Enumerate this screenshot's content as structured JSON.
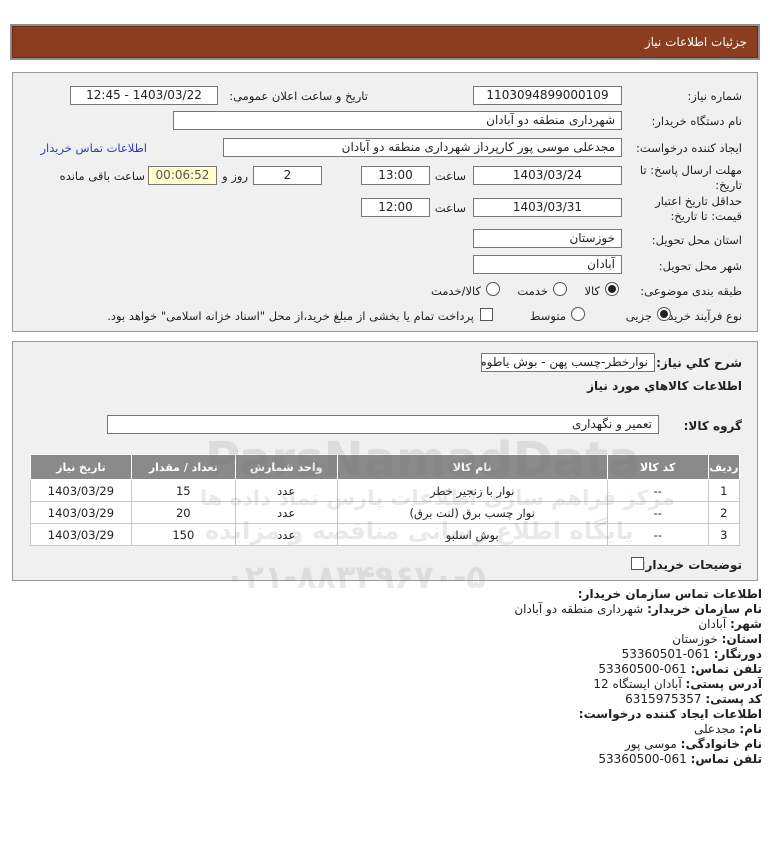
{
  "header": {
    "title": "جزئیات اطلاعات نیاز"
  },
  "form": {
    "need_number": {
      "label": "شماره نیاز:",
      "value": "1103094899000109"
    },
    "announce_datetime": {
      "label": "تاریخ و ساعت اعلان عمومی:",
      "value": "1403/03/22 - 12:45"
    },
    "buyer_org": {
      "label": "نام دستگاه خریدار:",
      "value": "شهرداری منطقه دو آبادان"
    },
    "requester": {
      "label": "ایجاد کننده درخواست:",
      "value": "مجدعلی موسی پور کارپرداز شهرداری منطقه دو آبادان"
    },
    "buyer_contact_link": "اطلاعات تماس خریدار",
    "response_deadline": {
      "label_line1": "مهلت ارسال پاسخ: تا",
      "label_line2": "تاریخ:",
      "date": "1403/03/24",
      "time_label": "ساعت",
      "time": "13:00",
      "days": "2",
      "days_label": "روز و",
      "remaining": "00:06:52",
      "remaining_label": "ساعت باقی مانده"
    },
    "price_validity": {
      "label_line1": "حداقل تاریخ اعتبار",
      "label_line2": "قیمت: تا تاریخ:",
      "date": "1403/03/31",
      "time_label": "ساعت",
      "time": "12:00"
    },
    "province": {
      "label": "استان محل تحویل:",
      "value": "خوزستان"
    },
    "city": {
      "label": "شهر محل تحویل:",
      "value": "آبادان"
    },
    "category": {
      "label": "طبقه بندی موضوعی:",
      "options": [
        "کالا",
        "خدمت",
        "کالا/خدمت"
      ],
      "selected": "کالا"
    },
    "process_type": {
      "label": "نوع فرآیند خرید :",
      "options": [
        "جزیی",
        "متوسط"
      ],
      "selected": "جزیی",
      "payment_note": "پرداخت تمام یا بخشی از مبلغ خرید،از محل \"اسناد خزانه اسلامی\" خواهد بود."
    }
  },
  "need_details": {
    "summary_label": "شرح کلي نياز:",
    "summary_value": "نوارخطر-چسب پهن - بوش یاطوم",
    "goods_info_title": "اطلاعات کالاهاي مورد نياز",
    "goods_group_label": "گروه کالا:",
    "goods_group_value": "تعمیر و نگهداری",
    "table": {
      "headers": [
        "ردیف",
        "کد کالا",
        "نام کالا",
        "واحد شمارش",
        "تعداد / مقدار",
        "تاریخ نیاز"
      ],
      "rows": [
        [
          "1",
          "--",
          "نوار با زنجیر خطر",
          "عدد",
          "15",
          "1403/03/29"
        ],
        [
          "2",
          "--",
          "نوار چسب برق (لنت برق)",
          "عدد",
          "20",
          "1403/03/29"
        ],
        [
          "3",
          "--",
          "بوش اسلبو",
          "عدد",
          "150",
          "1403/03/29"
        ]
      ]
    },
    "buyer_notes_label": "توضیحات خریدار:"
  },
  "contact_info": {
    "title_buyer": "اطلاعات تماس سازمان خریدار:",
    "org_name_label": "نام سازمان خریدار:",
    "org_name": "شهرداری منطقه دو آبادان",
    "city_label": "شهر:",
    "city": "آبادان",
    "province_label": "استان:",
    "province": "خوزستان",
    "fax_label": "دورنگار:",
    "fax": "061-53360501",
    "phone_label": "تلفن تماس:",
    "phone": "061-53360500",
    "address_label": "آدرس پستی:",
    "address": "آبادان ایستگاه 12",
    "postal_label": "کد پستی:",
    "postal": "6315975357",
    "title_requester": "اطلاعات ایجاد کننده درخواست:",
    "name_label": "نام:",
    "name": "مجدعلی",
    "family_label": "نام خانوادگی:",
    "family": "موسی پور",
    "req_phone_label": "تلفن تماس:",
    "req_phone": "061-53360500"
  },
  "watermark": {
    "brand": "ParsNamadData",
    "line1": "مرکز فراهم سازی اطلاعات پارس نماد داده ها",
    "line2": "پایگاه اطلاع رسانی مناقصه و مزایده",
    "phone": "۰۲۱-۸۸۳۴۹۶۷۰-۵"
  }
}
